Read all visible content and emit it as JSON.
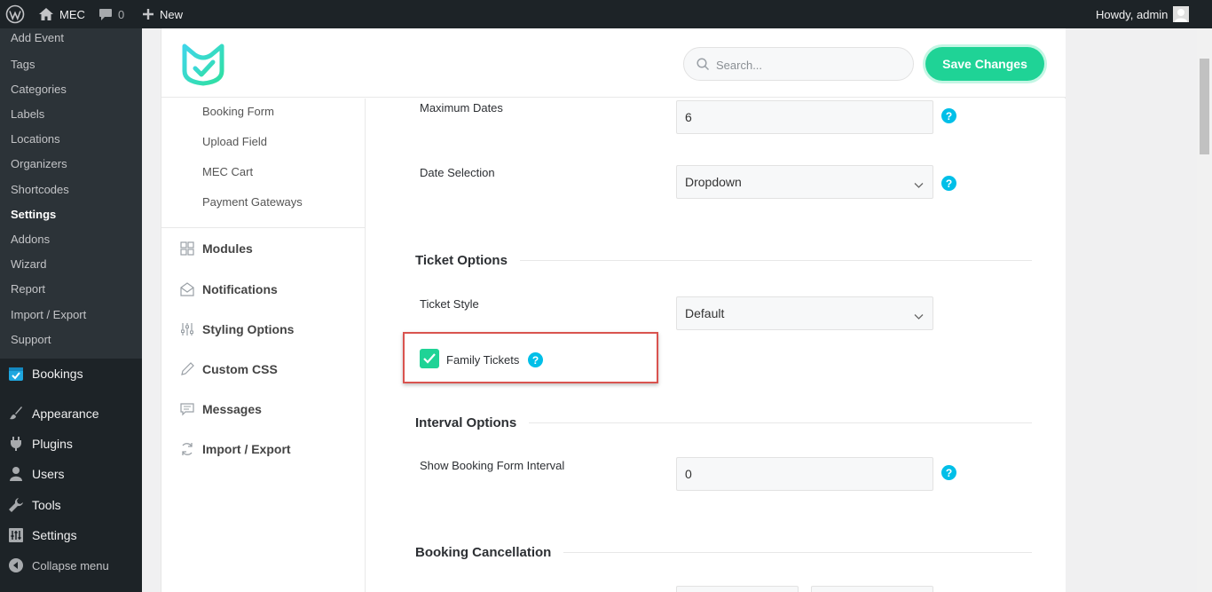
{
  "adminbar": {
    "site_name": "MEC",
    "comments_count": "0",
    "new_label": "New",
    "howdy": "Howdy, admin"
  },
  "sidebar": {
    "submenu": [
      {
        "label": "Add Event"
      },
      {
        "label": "Tags"
      },
      {
        "label": "Categories"
      },
      {
        "label": "Labels"
      },
      {
        "label": "Locations"
      },
      {
        "label": "Organizers"
      },
      {
        "label": "Shortcodes"
      },
      {
        "label": "Settings",
        "current": true
      },
      {
        "label": "Addons"
      },
      {
        "label": "Wizard"
      },
      {
        "label": "Report"
      },
      {
        "label": "Import / Export"
      },
      {
        "label": "Support"
      }
    ],
    "menu": [
      {
        "label": "Bookings",
        "icon": "bookings-icon"
      },
      {
        "label": "Appearance",
        "icon": "paintbrush-icon"
      },
      {
        "label": "Plugins",
        "icon": "plugin-icon"
      },
      {
        "label": "Users",
        "icon": "user-icon"
      },
      {
        "label": "Tools",
        "icon": "wrench-icon"
      },
      {
        "label": "Settings",
        "icon": "sliders-icon"
      }
    ],
    "collapse_label": "Collapse menu"
  },
  "header": {
    "search_placeholder": "Search...",
    "save_label": "Save Changes",
    "accent_color": "#1fd396"
  },
  "settings_nav": {
    "sub_items": [
      "Booking Form",
      "Upload Field",
      "MEC Cart",
      "Payment Gateways"
    ],
    "items": [
      {
        "label": "Modules",
        "icon": "grid-icon"
      },
      {
        "label": "Notifications",
        "icon": "envelope-icon"
      },
      {
        "label": "Styling Options",
        "icon": "sliders-icon"
      },
      {
        "label": "Custom CSS",
        "icon": "pencil-icon"
      },
      {
        "label": "Messages",
        "icon": "message-icon"
      },
      {
        "label": "Import / Export",
        "icon": "sync-icon"
      }
    ]
  },
  "form": {
    "maximum_dates": {
      "label": "Maximum Dates",
      "value": "6"
    },
    "date_selection": {
      "label": "Date Selection",
      "value": "Dropdown"
    },
    "ticket_options": {
      "title": "Ticket Options"
    },
    "ticket_style": {
      "label": "Ticket Style",
      "value": "Default"
    },
    "family_tickets": {
      "label": "Family Tickets",
      "checked": true
    },
    "interval_options": {
      "title": "Interval Options"
    },
    "booking_form_interval": {
      "label": "Show Booking Form Interval",
      "value": "0"
    },
    "booking_cancellation": {
      "title": "Booking Cancellation"
    },
    "help_glyph": "?"
  }
}
